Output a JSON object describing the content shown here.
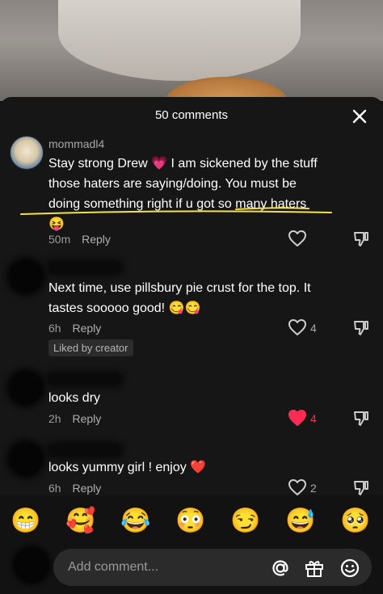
{
  "header": {
    "title": "50 comments"
  },
  "comments": [
    {
      "username": "mommadl4",
      "text_line1": "Stay strong Drew 💗  I am sickened by the stuff",
      "text_line2_a": "those haters are saying/doing. ",
      "text_line2_b": "You must be",
      "text_line3": "doing something right if u got so many haters",
      "text_line4": "😝",
      "time": "50m",
      "reply": "Reply",
      "likes": ""
    },
    {
      "username": "",
      "text_line1": "Next time, use pillsbury pie crust for the top. It",
      "text_line2": "tastes sooooo good! 😋😋",
      "time": "6h",
      "reply": "Reply",
      "likes": "4",
      "badge": "Liked by creator"
    },
    {
      "username": "",
      "text_line1": "looks dry",
      "time": "2h",
      "reply": "Reply",
      "likes": "4",
      "liked_color": "#fe2c55"
    },
    {
      "username": "",
      "text_line1": "looks yummy girl ! enjoy ❤️",
      "time": "6h",
      "reply": "Reply",
      "likes": "2"
    }
  ],
  "emoji_bar": [
    "😁",
    "🥰",
    "😂",
    "😳",
    "😏",
    "😅",
    "🥺"
  ],
  "input": {
    "placeholder": "Add comment..."
  },
  "icons": [
    "close-icon",
    "heart-icon",
    "dislike-icon",
    "at-icon",
    "gift-icon",
    "emoji-icon"
  ],
  "colors": {
    "accent_like": "#fe2c55",
    "highlight_underline": "#f5e04a"
  }
}
